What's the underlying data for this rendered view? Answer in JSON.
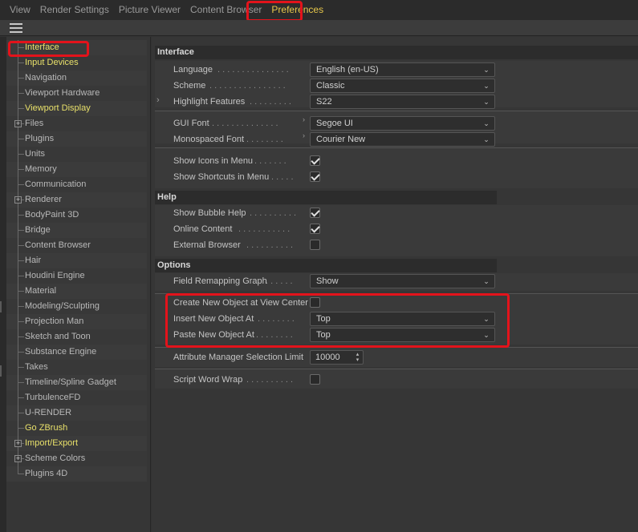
{
  "menubar": {
    "items": [
      "View",
      "Render Settings",
      "Picture Viewer",
      "Content Browser",
      "Preferences"
    ]
  },
  "sidebar": {
    "items": [
      {
        "label": "Interface",
        "highlight": true,
        "expander": false
      },
      {
        "label": "Input Devices",
        "highlight": true,
        "expander": false
      },
      {
        "label": "Navigation",
        "highlight": false,
        "expander": false
      },
      {
        "label": "Viewport Hardware",
        "highlight": false,
        "expander": false
      },
      {
        "label": "Viewport Display",
        "highlight": true,
        "expander": false
      },
      {
        "label": "Files",
        "highlight": false,
        "expander": true
      },
      {
        "label": "Plugins",
        "highlight": false,
        "expander": false
      },
      {
        "label": "Units",
        "highlight": false,
        "expander": false
      },
      {
        "label": "Memory",
        "highlight": false,
        "expander": false
      },
      {
        "label": "Communication",
        "highlight": false,
        "expander": false
      },
      {
        "label": "Renderer",
        "highlight": false,
        "expander": true
      },
      {
        "label": "BodyPaint 3D",
        "highlight": false,
        "expander": false
      },
      {
        "label": "Bridge",
        "highlight": false,
        "expander": false
      },
      {
        "label": "Content Browser",
        "highlight": false,
        "expander": false
      },
      {
        "label": "Hair",
        "highlight": false,
        "expander": false
      },
      {
        "label": "Houdini Engine",
        "highlight": false,
        "expander": false
      },
      {
        "label": "Material",
        "highlight": false,
        "expander": false
      },
      {
        "label": "Modeling/Sculpting",
        "highlight": false,
        "expander": false
      },
      {
        "label": "Projection Man",
        "highlight": false,
        "expander": false
      },
      {
        "label": "Sketch and Toon",
        "highlight": false,
        "expander": false
      },
      {
        "label": "Substance Engine",
        "highlight": false,
        "expander": false
      },
      {
        "label": "Takes",
        "highlight": false,
        "expander": false
      },
      {
        "label": "Timeline/Spline Gadget",
        "highlight": false,
        "expander": false
      },
      {
        "label": "TurbulenceFD",
        "highlight": false,
        "expander": false
      },
      {
        "label": "U-RENDER",
        "highlight": false,
        "expander": false
      },
      {
        "label": "Go ZBrush",
        "highlight": true,
        "expander": false
      },
      {
        "label": "Import/Export",
        "highlight": true,
        "expander": true
      },
      {
        "label": "Scheme Colors",
        "highlight": false,
        "expander": true
      },
      {
        "label": "Plugins 4D",
        "highlight": false,
        "expander": false
      }
    ]
  },
  "interface": {
    "header": "Interface",
    "language": {
      "label": "Language",
      "value": "English (en-US)"
    },
    "scheme": {
      "label": "Scheme",
      "value": "Classic"
    },
    "highlight_features": {
      "label": "Highlight Features",
      "value": "S22"
    },
    "gui_font": {
      "label": "GUI Font",
      "value": "Segoe UI"
    },
    "mono_font": {
      "label": "Monospaced Font",
      "value": "Courier New"
    },
    "show_icons": {
      "label": "Show Icons in Menu",
      "checked": true
    },
    "show_shortcuts": {
      "label": "Show Shortcuts in Menu",
      "checked": true
    }
  },
  "help": {
    "header": "Help",
    "bubble_help": {
      "label": "Show Bubble Help",
      "checked": true
    },
    "online_content": {
      "label": "Online Content",
      "checked": true
    },
    "external_browser": {
      "label": "External Browser",
      "checked": false
    }
  },
  "options": {
    "header": "Options",
    "field_remapping": {
      "label": "Field Remapping Graph",
      "value": "Show"
    },
    "create_at_view_center": {
      "label": "Create New Object at View Center",
      "checked": false
    },
    "insert_new_object": {
      "label": "Insert New Object At",
      "value": "Top"
    },
    "paste_new_object": {
      "label": "Paste New Object At",
      "value": "Top"
    },
    "attr_selection_limit": {
      "label": "Attribute Manager Selection Limit",
      "value": "10000"
    },
    "script_word_wrap": {
      "label": "Script Word Wrap",
      "checked": false
    }
  },
  "colors": {
    "highlight_text": "#e8e06a",
    "active_menu": "#e8c84a",
    "annotation_red": "#e3131b"
  }
}
